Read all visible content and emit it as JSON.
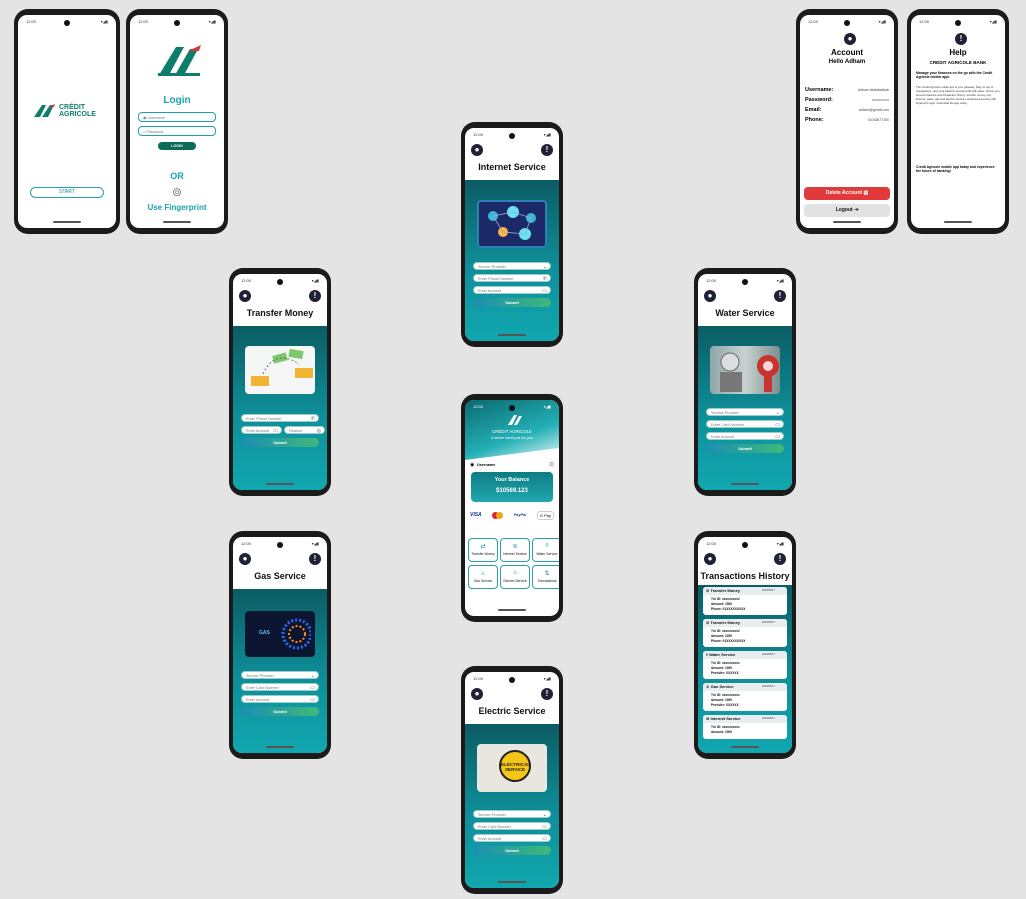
{
  "status_time": "12:00",
  "status_icons": "▾◢▮",
  "splash": {
    "logo_line1": "CRÉDIT",
    "logo_line2": "AGRICOLE",
    "start_label": "START"
  },
  "login": {
    "title": "Login",
    "username_placeholder": "Username",
    "password_placeholder": "Password",
    "login_label": "LOGIN",
    "or_label": "OR",
    "fingerprint_label": "Use Fingerprint"
  },
  "account": {
    "title": "Account",
    "greeting": "Hello Adham",
    "rows": [
      {
        "label": "Username:",
        "value": "Adham Abdelwahab"
      },
      {
        "label": "Password:",
        "value": "••••••••••••••"
      },
      {
        "label": "Email:",
        "value": "adham@gmail.com"
      },
      {
        "label": "Phone:",
        "value": "01016877100"
      }
    ],
    "delete_label": "Delete Account",
    "logout_label": "Logout"
  },
  "help": {
    "title": "Help",
    "subtitle": "CREDIT AGRICOLE BANK",
    "lead": "Manage your finances on the go with the Credit Agricole mobile app!",
    "body": "The Credit Agricole mobile app is your gateway. Stay on top of transactions, view your balance and pay bills with ease. Check your account balance and transaction history, transfer money, pay internet, water, gas and electric services. Enhanced security with fingerprint login. Download the app today.",
    "closing": "Credit Agricole mobile app today and experience the future of banking!"
  },
  "internet": {
    "title": "Internet Service",
    "provider": "Service Provider",
    "phone": "Enter Phone Number",
    "amount": "Enter Amount",
    "submit": "Submit"
  },
  "transfer": {
    "title": "Transfer Money",
    "phone": "Enter Phone Number",
    "amount": "Enter Amount",
    "reason": "Reason",
    "submit": "Submit"
  },
  "water": {
    "title": "Water Service",
    "provider": "Service Provider",
    "card": "Enter Card Number",
    "amount": "Enter Amount",
    "submit": "Submit"
  },
  "home": {
    "brand": "CRÉDIT AGRICOLE",
    "tagline": "A whole bank just for you",
    "username": "Username",
    "balance_label": "Your Balance",
    "balance_value": "$10569.123",
    "cards": [
      "VISA",
      "PayPal",
      "G Pay"
    ],
    "tiles": [
      "Transfer Money",
      "Internet Service",
      "Water Service",
      "Gas Service",
      "Electric Service",
      "Transactions"
    ]
  },
  "gas": {
    "title": "Gas Service",
    "provider": "Service Provider",
    "card": "Enter Card Number",
    "amount": "Enter Amount",
    "submit": "Submit"
  },
  "transactions": {
    "title": "Transactions History",
    "items": [
      {
        "name": "Transfer Money",
        "date": "2023/06/17",
        "id": "Trn ID: xxxxxxxxxx",
        "amount": "Amount: 1500",
        "extra": "Phone: 01XXXXXXXXX"
      },
      {
        "name": "Transfer Money",
        "date": "2023/06/17",
        "id": "Trn ID: xxxxxxxxxx",
        "amount": "Amount: 2250",
        "extra": "Phone: 01XXXXXXXXX"
      },
      {
        "name": "Water Service",
        "date": "2023/06/17",
        "id": "Trn ID: xxxxxxxxxx",
        "amount": "Amount: 1000",
        "extra": "Provider: XXXXXX"
      },
      {
        "name": "Gas Service",
        "date": "2023/06/17",
        "id": "Trn ID: xxxxxxxxxx",
        "amount": "Amount: 1000",
        "extra": "Provider: XXXXXX"
      },
      {
        "name": "Internet Service",
        "date": "2023/06/17",
        "id": "Trn ID: xxxxxxxxxx",
        "amount": "Amount: 1000",
        "extra": ""
      }
    ]
  },
  "electric": {
    "title": "Electric Service",
    "banner_line1": "ELECTRICAL",
    "banner_line2": "SERVICE",
    "provider": "Service Provider",
    "card": "Enter Card Number",
    "amount": "Enter Amount",
    "submit": "Submit"
  },
  "gas_banner": "GAS",
  "colors": {
    "teal_dark": "#0b5c63",
    "teal": "#0e8f99",
    "danger": "#e03a3a",
    "accent_green": "#40b87a"
  }
}
